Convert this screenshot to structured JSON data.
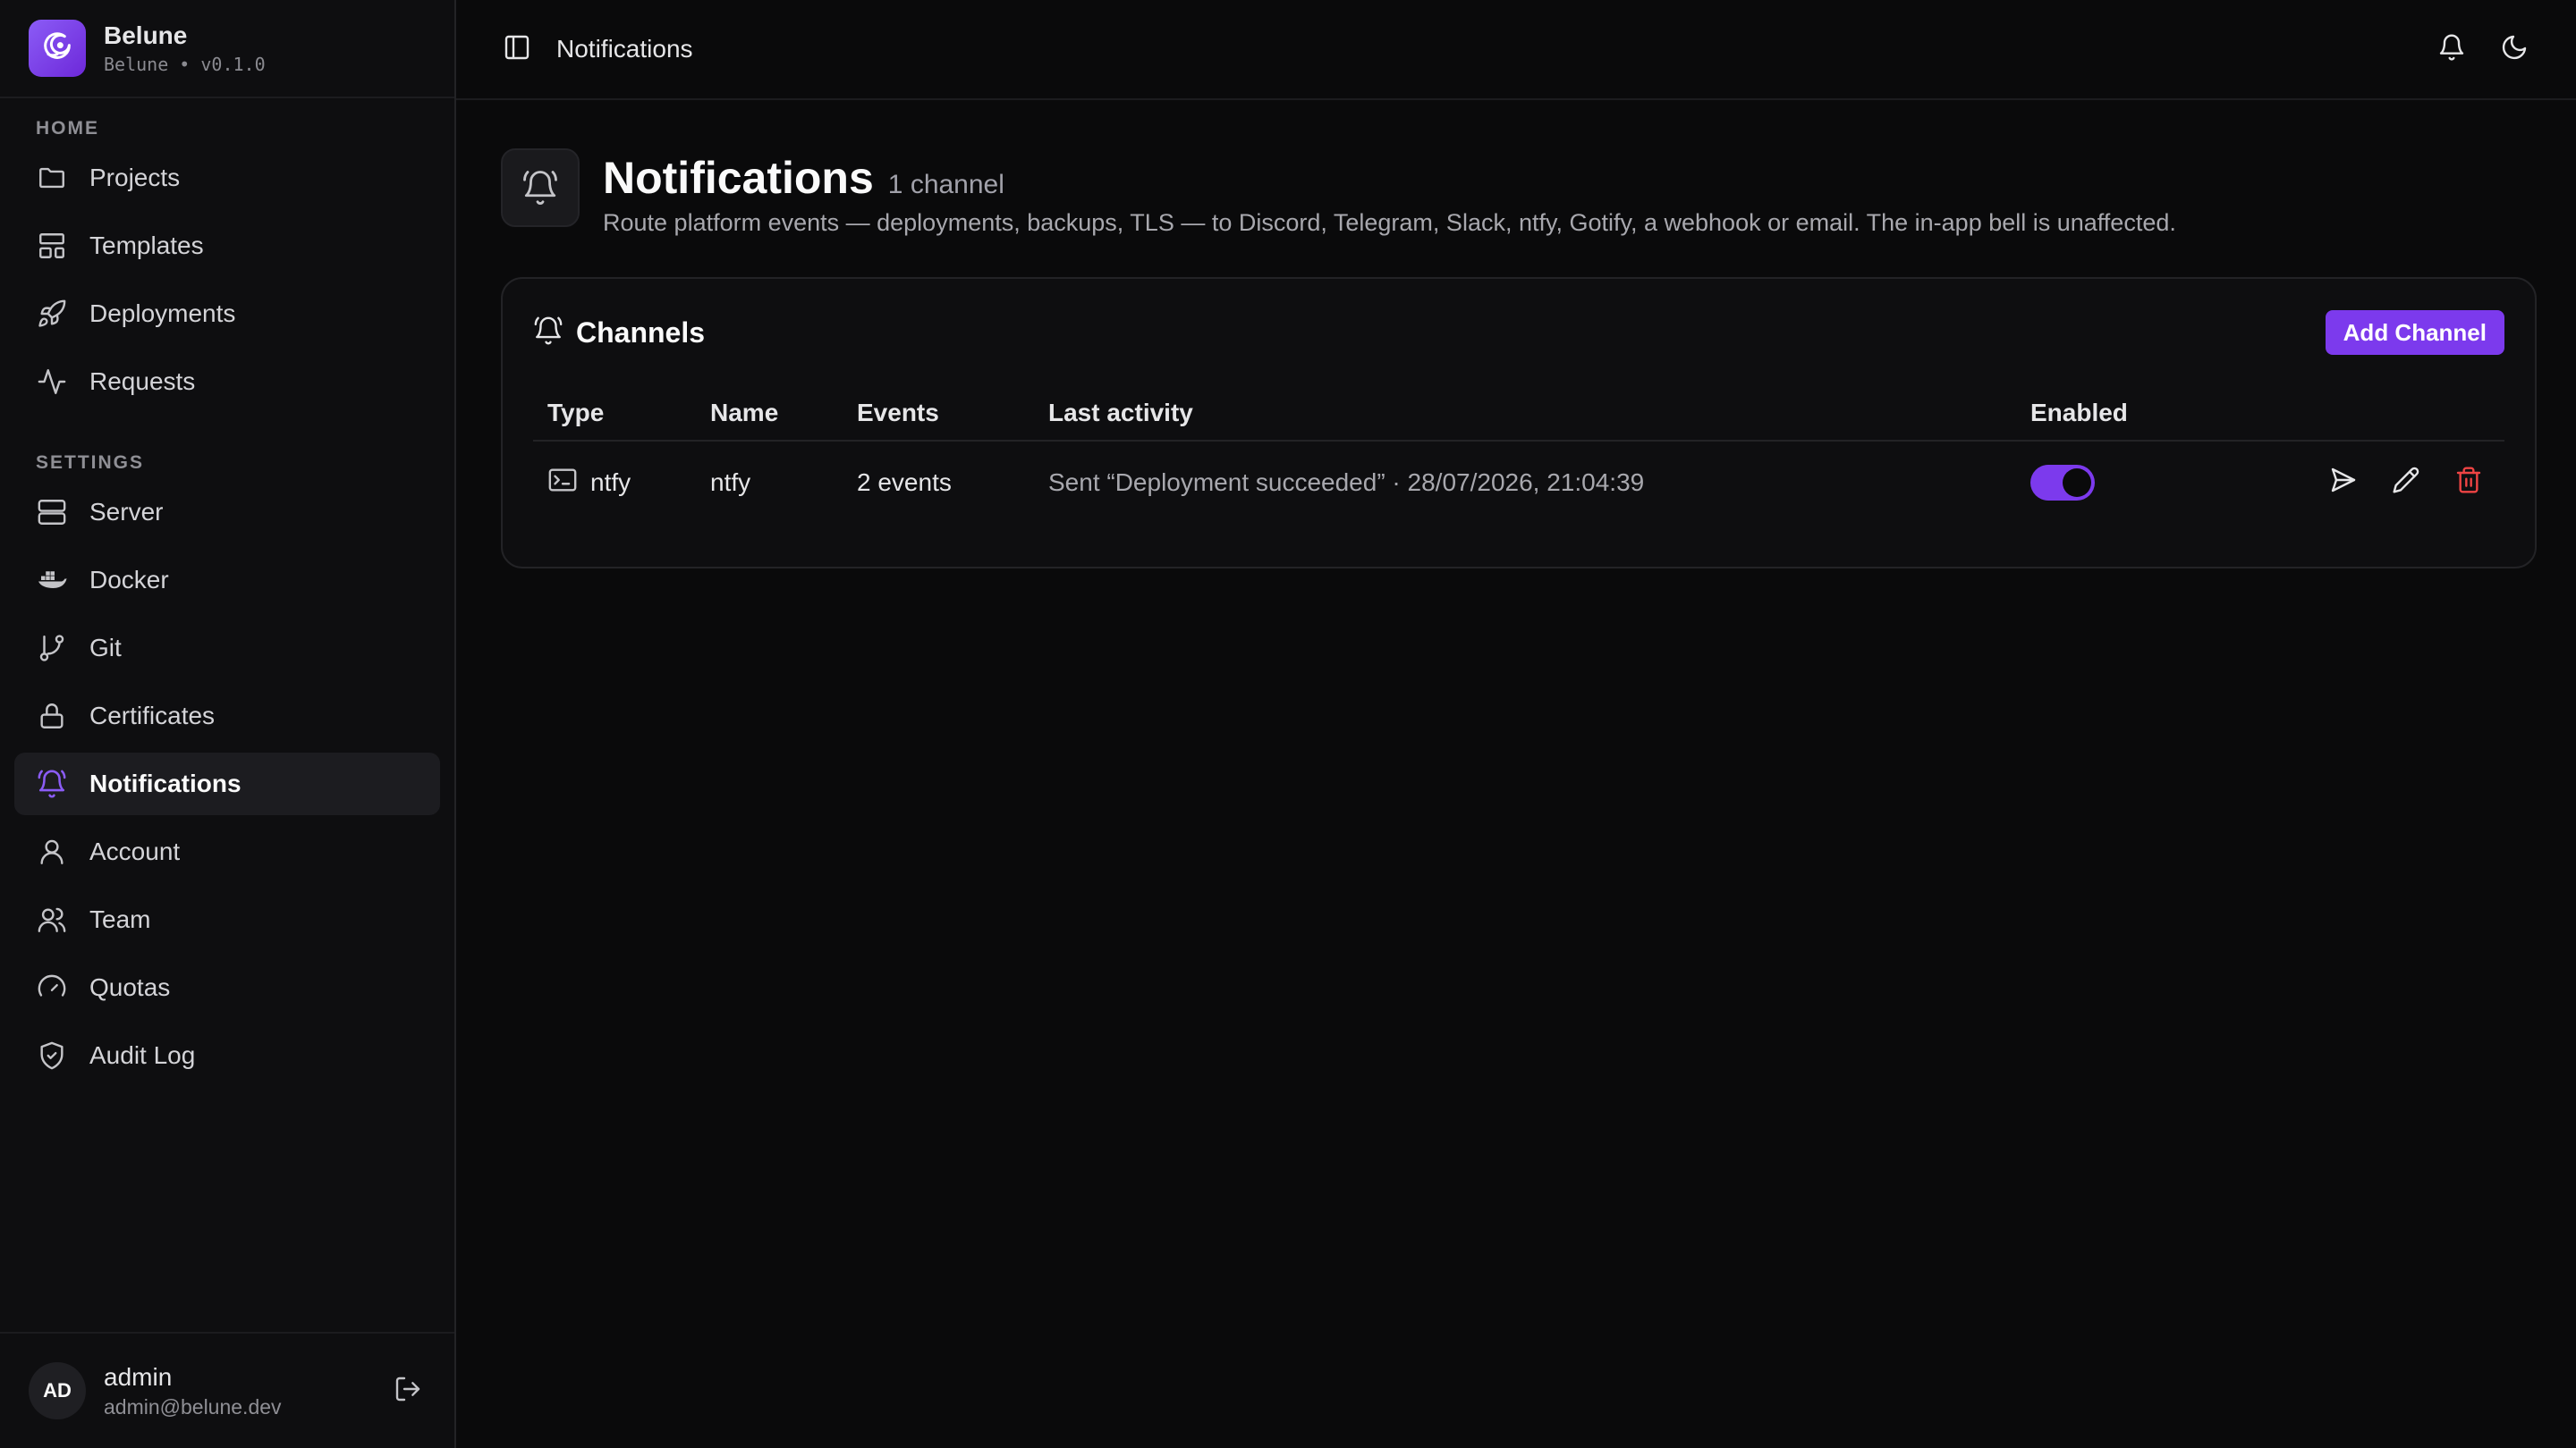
{
  "brand": {
    "name": "Belune",
    "subtitle": "Belune • v0.1.0"
  },
  "sidebar": {
    "home_label": "HOME",
    "settings_label": "SETTINGS",
    "home_items": [
      {
        "label": "Projects",
        "icon": "folder-icon"
      },
      {
        "label": "Templates",
        "icon": "layout-icon"
      },
      {
        "label": "Deployments",
        "icon": "rocket-icon"
      },
      {
        "label": "Requests",
        "icon": "activity-icon"
      }
    ],
    "settings_items": [
      {
        "label": "Server",
        "icon": "server-icon"
      },
      {
        "label": "Docker",
        "icon": "docker-icon"
      },
      {
        "label": "Git",
        "icon": "git-branch-icon"
      },
      {
        "label": "Certificates",
        "icon": "lock-icon"
      },
      {
        "label": "Notifications",
        "icon": "bell-icon",
        "active": true
      },
      {
        "label": "Account",
        "icon": "user-icon"
      },
      {
        "label": "Team",
        "icon": "users-icon"
      },
      {
        "label": "Quotas",
        "icon": "gauge-icon"
      },
      {
        "label": "Audit Log",
        "icon": "shield-check-icon"
      }
    ]
  },
  "user": {
    "initials": "AD",
    "name": "admin",
    "email": "admin@belune.dev"
  },
  "topbar": {
    "breadcrumb": "Notifications"
  },
  "page": {
    "title": "Notifications",
    "count": "1 channel",
    "description": "Route platform events — deployments, backups, TLS — to Discord, Telegram, Slack, ntfy, Gotify, a webhook or email. The in-app bell is unaffected."
  },
  "channels": {
    "title": "Channels",
    "add_label": "Add Channel",
    "columns": [
      "Type",
      "Name",
      "Events",
      "Last activity",
      "Enabled"
    ],
    "rows": [
      {
        "type": "ntfy",
        "name": "ntfy",
        "events": "2 events",
        "last_activity": "Sent “Deployment succeeded” · 28/07/2026, 21:04:39",
        "enabled": true
      }
    ]
  },
  "colors": {
    "accent": "#7c3aed",
    "danger": "#ef4444",
    "background": "#0a0a0b"
  }
}
